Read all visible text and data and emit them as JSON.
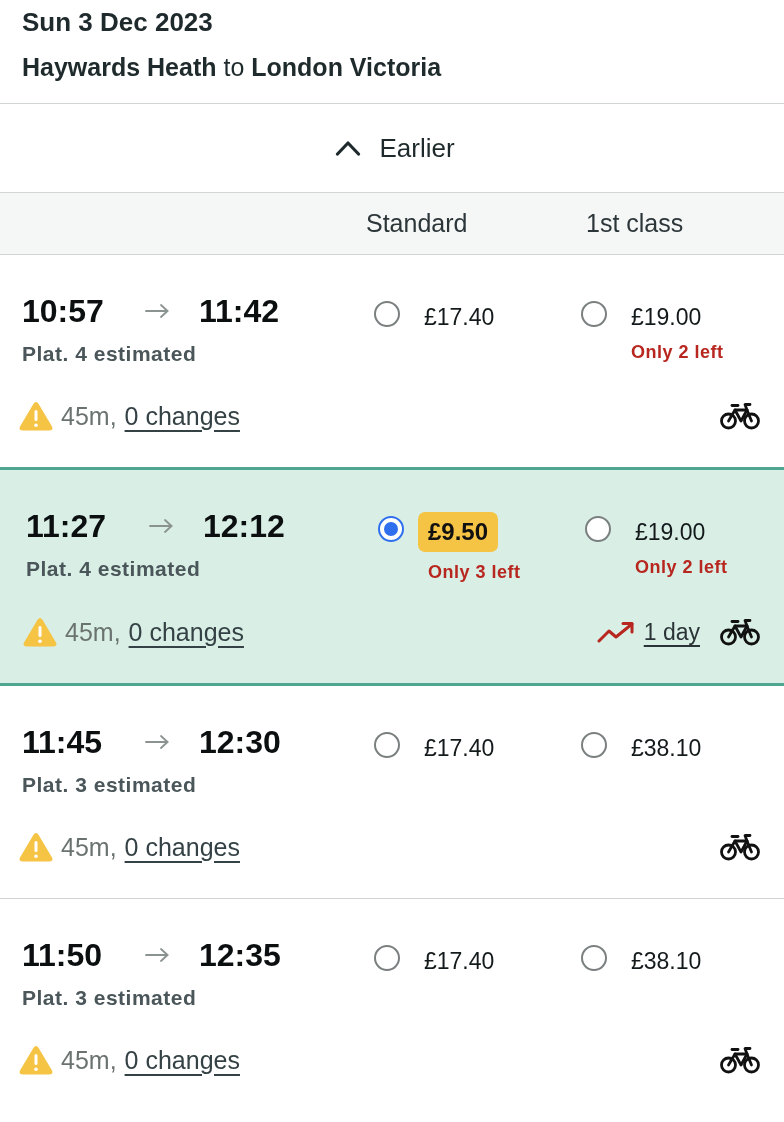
{
  "date": "Sun 3 Dec 2023",
  "route": "**Haywards Heath** to **London Victoria**",
  "earlier_button": {
    "label": "Earlier"
  },
  "fare_columns": [
    "Standard",
    "1st class"
  ],
  "journeys": [
    {
      "depart": "10:57",
      "arrive": "11:42",
      "platform": "Plat. 4 estimated",
      "selected": false,
      "duration": "45m,",
      "changes": "0 changes",
      "fares": [
        {
          "price": "£17.40",
          "selected": false,
          "highlighted": false
        },
        {
          "price": "£19.00",
          "selected": false,
          "highlighted": false,
          "note": "Only 2 left"
        }
      ]
    },
    {
      "depart": "11:27",
      "arrive": "12:12",
      "platform": "Plat. 4 estimated",
      "selected": true,
      "duration": "45m,",
      "changes": "0 changes",
      "price_alert": "1 day",
      "fares": [
        {
          "price": "£9.50",
          "selected": true,
          "highlighted": true,
          "note": "Only 3 left"
        },
        {
          "price": "£19.00",
          "selected": false,
          "highlighted": false,
          "note": "Only 2 left"
        }
      ]
    },
    {
      "depart": "11:45",
      "arrive": "12:30",
      "platform": "Plat. 3 estimated",
      "selected": false,
      "duration": "45m,",
      "changes": "0 changes",
      "fares": [
        {
          "price": "£17.40",
          "selected": false,
          "highlighted": false
        },
        {
          "price": "£38.10",
          "selected": false,
          "highlighted": false
        }
      ]
    },
    {
      "depart": "11:50",
      "arrive": "12:35",
      "platform": "Plat. 3 estimated",
      "selected": false,
      "duration": "45m,",
      "changes": "0 changes",
      "fares": [
        {
          "price": "£17.40",
          "selected": false,
          "highlighted": false
        },
        {
          "price": "£38.10",
          "selected": false,
          "highlighted": false
        }
      ]
    }
  ]
}
